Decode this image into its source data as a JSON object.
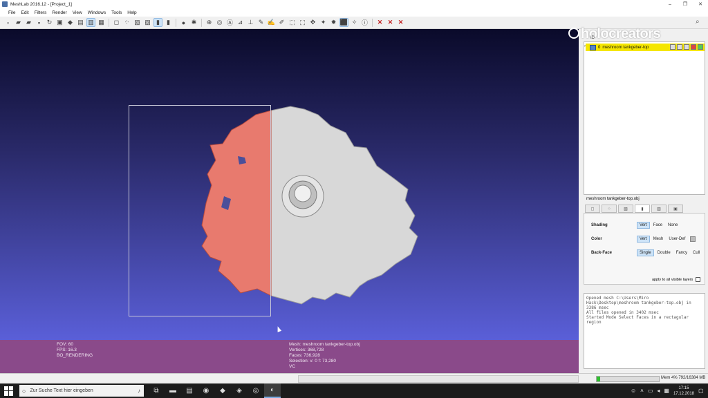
{
  "window": {
    "title": "MeshLab 2016.12 - [Project_1]",
    "controls": [
      "–",
      "❐",
      "✕"
    ]
  },
  "menu": [
    "File",
    "Edit",
    "Filters",
    "Render",
    "View",
    "Windows",
    "Tools",
    "Help"
  ],
  "watermark": "holocreators",
  "viewport_info": {
    "left": [
      "FOV: 60",
      "FPS:     16.3",
      "BO_RENDERING"
    ],
    "right": [
      "Mesh: meshroom tankgeber-top.obj",
      "Vertices: 368,728",
      "Faces: 736,928",
      "Selection: v: 0 f: 73,280",
      "VC"
    ]
  },
  "layers": {
    "header": "ID",
    "row": {
      "index": "0",
      "name": "meshroom tankgeber-top"
    }
  },
  "render_panel": {
    "filename": "meshroom tankgeber-top.obj",
    "shading": {
      "label": "Shading",
      "options": [
        "Vert",
        "Face",
        "None"
      ],
      "selected": "Vert"
    },
    "color": {
      "label": "Color",
      "options": [
        "Vert",
        "Mesh",
        "User-Def"
      ],
      "selected": "Vert"
    },
    "backface": {
      "label": "Back-Face",
      "options": [
        "Single",
        "Double",
        "Fancy",
        "Cull"
      ],
      "selected": "Single"
    },
    "apply_all": "apply to all visible layers"
  },
  "log": "Opened mesh C:\\Users\\Miro Hack\\Desktop\\meshroom tankgeber-top.obj in 3386 msec\nAll files opened in 3402 msec\nStarted Mode Select Faces in a rectagular region",
  "status": {
    "memory": "Mem 4% 792/16384 MB",
    "memory_fraction": 0.05
  },
  "taskbar": {
    "search_placeholder": "Zur Suche Text hier eingeben",
    "time": "17:15",
    "date": "17.12.2018"
  }
}
